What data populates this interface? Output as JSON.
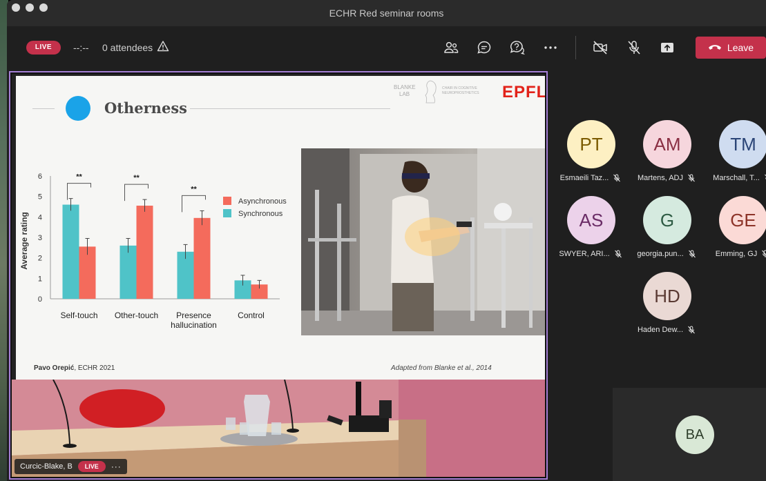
{
  "window": {
    "title": "ECHR Red seminar rooms"
  },
  "toolbar": {
    "live_label": "LIVE",
    "timer": "--:--",
    "attendees": "0 attendees",
    "leave_label": "Leave"
  },
  "slide": {
    "title": "Otherness",
    "logo_lab_text": "BLANKE LAB",
    "logo_chair_text": "CHAIR IN COGNITIVE NEUROPROSTHETICS",
    "logo_epfl": "EPFL",
    "footer_author": "Pavo Orepić",
    "footer_event": ", ECHR 2021",
    "footer_credit": "Adapted from Blanke et al., 2014"
  },
  "chart_data": {
    "type": "bar",
    "title": "",
    "xlabel": "",
    "ylabel": "Average rating",
    "ylim": [
      0,
      6
    ],
    "yticks": [
      "0",
      "1",
      "2",
      "3",
      "4",
      "5",
      "6"
    ],
    "categories": [
      "Self-touch",
      "Other-touch",
      "Presence hallucination",
      "Control"
    ],
    "category_lines": [
      [
        "Self-touch"
      ],
      [
        "Other-touch"
      ],
      [
        "Presence",
        "hallucination"
      ],
      [
        "Control"
      ]
    ],
    "series": [
      {
        "name": "Synchronous",
        "values": [
          4.6,
          2.6,
          2.3,
          0.9
        ],
        "errors": [
          0.3,
          0.35,
          0.35,
          0.25
        ],
        "color": "#4fc3c8"
      },
      {
        "name": "Asynchronous",
        "values": [
          2.55,
          4.55,
          3.95,
          0.7
        ],
        "errors": [
          0.4,
          0.3,
          0.35,
          0.2
        ],
        "color": "#f46b5c"
      }
    ],
    "significance": [
      "**",
      "**",
      "**"
    ],
    "legend": [
      "Asynchronous",
      "Synchronous"
    ],
    "legend_position": "top-right",
    "grid": false
  },
  "stage": {
    "presenter_name": "Curcic-Blake, B",
    "live_label": "LIVE",
    "more_label": "···"
  },
  "participants": [
    {
      "initials": "PT",
      "name": "Esmaeili Taz...",
      "bg": "#fdf0c3",
      "fg": "#7a5a00"
    },
    {
      "initials": "AM",
      "name": "Martens, ADJ",
      "bg": "#f6d6dd",
      "fg": "#8a2f43"
    },
    {
      "initials": "TM",
      "name": "Marschall, T...",
      "bg": "#cfdcf0",
      "fg": "#2b4577"
    },
    {
      "initials": "AS",
      "name": "SWYER, ARI...",
      "bg": "#ecd2ea",
      "fg": "#6a2c66"
    },
    {
      "initials": "G",
      "name": "georgia.pun...",
      "bg": "#d5eadf",
      "fg": "#2d5a43"
    },
    {
      "initials": "GE",
      "name": "Emming, GJ",
      "bg": "#fbdad6",
      "fg": "#8c3328"
    },
    {
      "initials": "HD",
      "name": "Haden Dew...",
      "bg": "#ead9d4",
      "fg": "#5a3a33"
    }
  ],
  "self_view": {
    "initials": "BA"
  }
}
